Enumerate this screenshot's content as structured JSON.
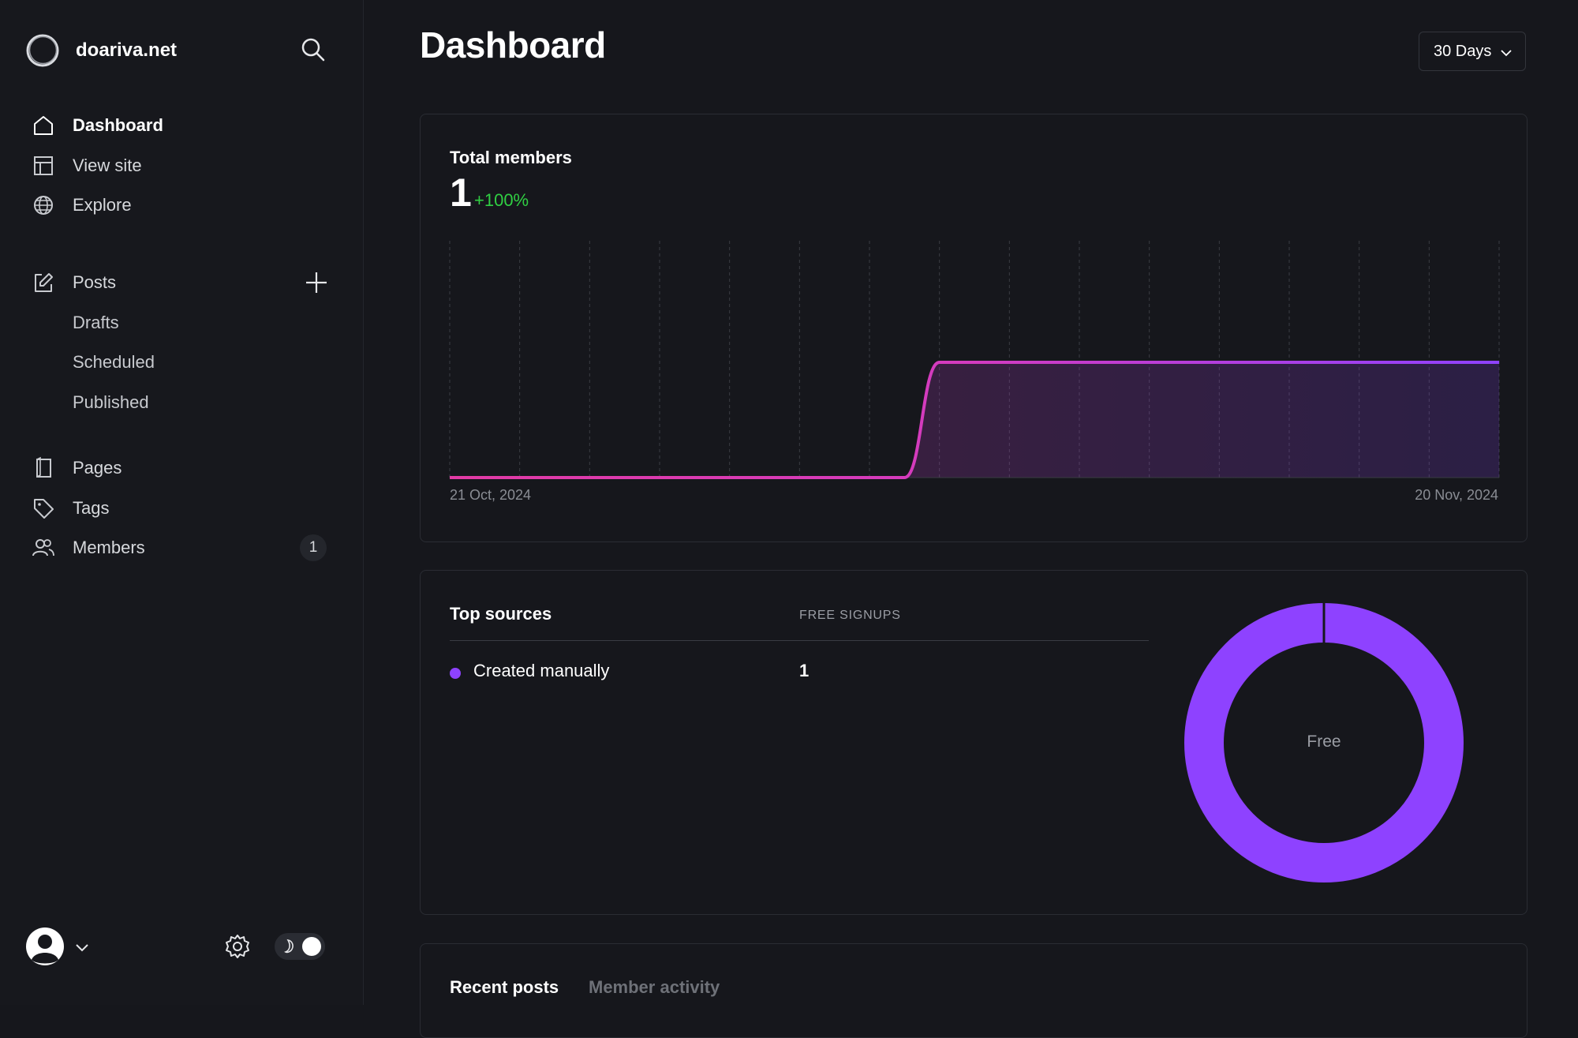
{
  "sidebar": {
    "site_name": "doariva.net",
    "primary": [
      {
        "label": "Dashboard",
        "icon": "home-icon"
      },
      {
        "label": "View site",
        "icon": "layout-icon"
      },
      {
        "label": "Explore",
        "icon": "globe-icon"
      }
    ],
    "posts": {
      "label": "Posts",
      "icon": "edit-icon",
      "sub": [
        "Drafts",
        "Scheduled",
        "Published"
      ]
    },
    "secondary": [
      {
        "label": "Pages",
        "icon": "page-icon"
      },
      {
        "label": "Tags",
        "icon": "tag-icon"
      },
      {
        "label": "Members",
        "icon": "members-icon",
        "count": "1"
      }
    ]
  },
  "header": {
    "title": "Dashboard",
    "range": "30 Days"
  },
  "members_card": {
    "title": "Total members",
    "value": "1",
    "delta": "+100%"
  },
  "chart_data": {
    "type": "area",
    "title": "Total members",
    "x_start_label": "21 Oct, 2024",
    "x_end_label": "20 Nov, 2024",
    "x": [
      "2024-10-21",
      "2024-10-22",
      "2024-10-23",
      "2024-10-24",
      "2024-10-25",
      "2024-10-26",
      "2024-10-27",
      "2024-10-28",
      "2024-10-29",
      "2024-10-30",
      "2024-10-31",
      "2024-11-01",
      "2024-11-02",
      "2024-11-03",
      "2024-11-04",
      "2024-11-05",
      "2024-11-06",
      "2024-11-07",
      "2024-11-08",
      "2024-11-09",
      "2024-11-10",
      "2024-11-11",
      "2024-11-12",
      "2024-11-13",
      "2024-11-14",
      "2024-11-15",
      "2024-11-16",
      "2024-11-17",
      "2024-11-18",
      "2024-11-19",
      "2024-11-20"
    ],
    "series": [
      {
        "values": [
          0,
          0,
          0,
          0,
          0,
          0,
          0,
          0,
          0,
          0,
          0,
          0,
          0,
          0,
          1,
          1,
          1,
          1,
          1,
          1,
          1,
          1,
          1,
          1,
          1,
          1,
          1,
          1,
          1,
          1,
          1
        ]
      }
    ],
    "ylim": [
      0,
      2
    ],
    "grid": "vertical-dashed",
    "colors": {
      "start": "#e23ba5",
      "end": "#8e42ff"
    }
  },
  "sources": {
    "title": "Top sources",
    "column": "FREE SIGNUPS",
    "rows": [
      {
        "name": "Created manually",
        "value": "1",
        "color": "#8e42ff"
      }
    ],
    "donut_label": "Free",
    "donut_color": "#8e42ff"
  },
  "tabs": [
    "Recent posts",
    "Member activity"
  ]
}
